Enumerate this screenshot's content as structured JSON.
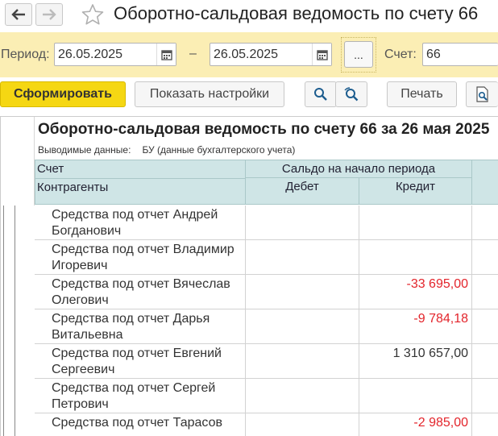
{
  "window": {
    "title": "Оборотно-сальдовая ведомость по счету 66"
  },
  "period": {
    "label": "Период:",
    "from": "26.05.2025",
    "separator": "–",
    "to": "26.05.2025",
    "dots": "...",
    "account_label": "Счет:",
    "account": "66"
  },
  "toolbar": {
    "generate": "Сформировать",
    "settings": "Показать настройки",
    "print": "Печать"
  },
  "report": {
    "title": "Оборотно-сальдовая ведомость по счету 66 за 26 мая 2025",
    "output_label": "Выводимые данные:",
    "output_value": "БУ (данные бухгалтерского учета)",
    "header": {
      "account": "Счет",
      "counterparties": "Контрагенты",
      "opening_balance": "Сальдо на начало периода",
      "debit": "Дебет",
      "credit": "Кредит"
    },
    "rows": [
      {
        "name": "Средства под отчет Андрей Богданович",
        "debit": "",
        "credit": "",
        "negative": false
      },
      {
        "name": "Средства под отчет Владимир Игоревич",
        "debit": "",
        "credit": "",
        "negative": false
      },
      {
        "name": "Средства под отчет Вячеслав Олегович",
        "debit": "",
        "credit": "-33 695,00",
        "negative": true
      },
      {
        "name": "Средства под отчет Дарья Витальевна",
        "debit": "",
        "credit": "-9 784,18",
        "negative": true
      },
      {
        "name": "Средства под отчет Евгений Сергеевич",
        "debit": "",
        "credit": "1 310 657,00",
        "negative": false
      },
      {
        "name": "Средства под отчет Сергей Петрович",
        "debit": "",
        "credit": "",
        "negative": false
      },
      {
        "name": "Средства под отчет Тарасов",
        "debit": "",
        "credit": "-2 985,00",
        "negative": true
      }
    ]
  }
}
